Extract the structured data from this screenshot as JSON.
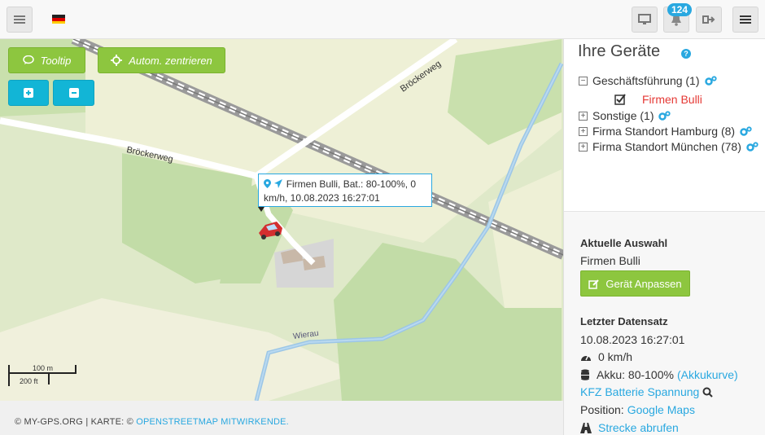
{
  "topbar": {
    "menu_icon": "hamburger-icon",
    "flag_icon": "german-flag-icon",
    "notification_count": "124",
    "right_menu_icon": "bars-icon"
  },
  "map": {
    "tooltip_button": "Tooltip",
    "autocenter_button": "Autom. zentrieren",
    "zoom_in": "+",
    "zoom_out": "−",
    "street_labels": [
      "Bröckerweg",
      "Bröckerweg",
      "Wierau"
    ],
    "vehicle_tooltip_line1": "Firmen Bulli, Bat.: 80-100%, 0",
    "vehicle_tooltip_line2": "km/h, 10.08.2023 16:27:01",
    "scale_metric": "100 m",
    "scale_imperial": "200 ft",
    "attribution_prefix": "© MY-GPS.ORG | KARTE: ©",
    "attribution_link": "OPENSTREETMAP MITWIRKENDE."
  },
  "panel": {
    "title": "Ihre Geräte",
    "tree": [
      {
        "label": "Geschäftsführung (1)",
        "expanded": true
      },
      {
        "label": "Firmen Bulli",
        "checked": true,
        "color": "#e53935"
      },
      {
        "label": "Sonstige (1)",
        "expanded": false
      },
      {
        "label": "Firma Standort Hamburg (8)",
        "expanded": false
      },
      {
        "label": "Firma Standort München (78)",
        "expanded": false
      }
    ],
    "current_selection_heading": "Aktuelle Auswahl",
    "current_selection_value": "Firmen Bulli",
    "adapt_button": "Gerät Anpassen",
    "last_record_heading": "Letzter Datensatz",
    "last_record_time": "10.08.2023 16:27:01",
    "speed": "0 km/h",
    "battery_prefix": "Akku: 80-100%",
    "battery_link": "(Akkukurve)",
    "kfz_link": "KFZ Batterie Spannung",
    "position_prefix": "Position:",
    "position_link": "Google Maps",
    "route_link": "Strecke abrufen"
  },
  "colors": {
    "accent": "#29a8e0",
    "green_button": "#8dc63f",
    "blue_button": "#12b5d6",
    "selected_device": "#e53935"
  }
}
